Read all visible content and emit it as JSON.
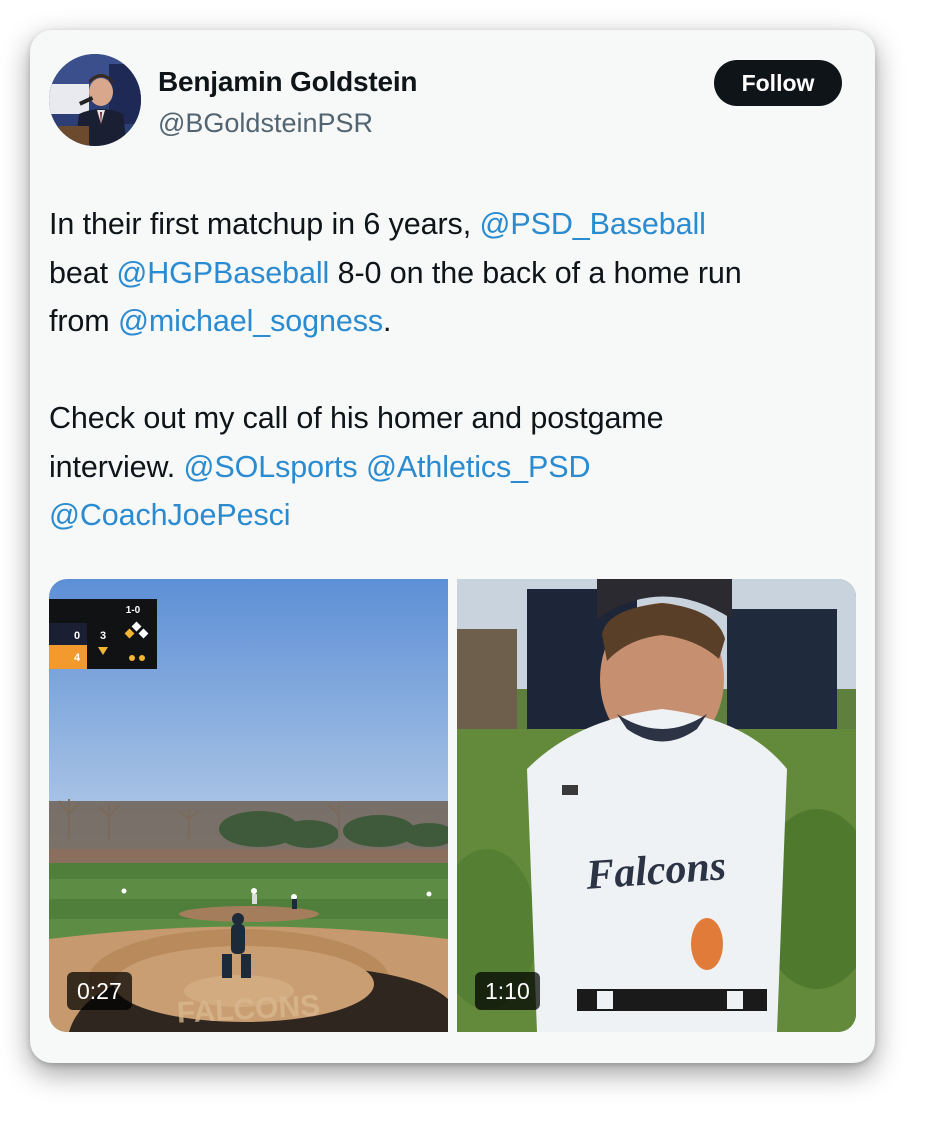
{
  "author": {
    "name": "Benjamin Goldstein",
    "handle": "@BGoldsteinPSR",
    "follow_label": "Follow"
  },
  "tweet": {
    "p1": [
      {
        "t": "In their first matchup in 6 years, ",
        "m": false
      },
      {
        "t": "@PSD_Baseball",
        "m": true
      },
      {
        "t": "beat ",
        "m": false
      },
      {
        "t": "@HGPBaseball",
        "m": true
      },
      {
        "t": " 8-0 on the back of a home run",
        "m": false
      },
      {
        "t": "from ",
        "m": false
      },
      {
        "t": "@michael_sogness",
        "m": true
      },
      {
        "t": ".",
        "m": false
      }
    ],
    "p2_line1": "Check out my call of his homer and postgame",
    "p2_line2_prefix": "interview. ",
    "mention_solsports": "@SOLsports",
    "mention_athletics": "@Athletics_PSD",
    "mention_coach": "@CoachJoePesci"
  },
  "media": [
    {
      "duration": "0:27",
      "scoreboard": {
        "count": "1-0",
        "away_score": "0",
        "home_score": "4",
        "inning": "3"
      },
      "field_lettering": "FALCONS"
    },
    {
      "duration": "1:10",
      "jersey_text": "Falcons"
    }
  ],
  "colors": {
    "mention": "#2a8bd0",
    "follow_bg": "#0f1419",
    "card_bg": "#f7f8f8"
  }
}
